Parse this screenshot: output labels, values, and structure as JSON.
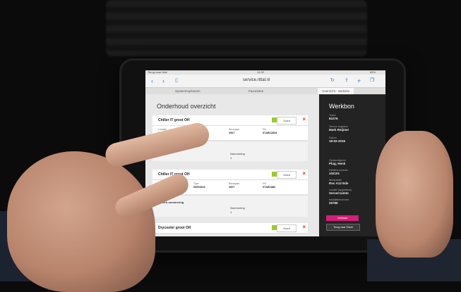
{
  "browser": {
    "back_label": "Terug naar Mail",
    "time": "14:32",
    "battery": "65%",
    "url": "service.rittal.nl"
  },
  "tabs": [
    "Systeemoplossen",
    "Favorieten",
    "Overzicht - Website"
  ],
  "page": {
    "title": "Onderhoud overzicht",
    "cards": [
      {
        "name": "Chiller IT groot OH",
        "status": "Goed",
        "fields": [
          {
            "label": "Locatie",
            "value": "Ede"
          },
          {
            "label": "Type",
            "value": "SKR4333"
          },
          {
            "label": "Bouwjaar",
            "value": "2007"
          },
          {
            "label": "FN",
            "value": "07AB12833"
          }
        ],
        "sub_label": "Nero-nummering",
        "sub_field_label": "Nummering",
        "sub_field_value": "1"
      },
      {
        "name": "Chiller IT groot OH",
        "status": "Goed",
        "fields": [
          {
            "label": "Locatie",
            "value": "Ede"
          },
          {
            "label": "Type",
            "value": "SKR4333"
          },
          {
            "label": "Bouwjaar",
            "value": "2007"
          },
          {
            "label": "FN",
            "value": "07AB1883"
          }
        ],
        "sub_label": "Nero-nummering",
        "sub_field_label": "Nummering",
        "sub_field_value": "1"
      },
      {
        "name": "Drycooler groot OH",
        "status": "Goed",
        "fields": [
          {
            "label": "Locatie",
            "value": ""
          },
          {
            "label": "Type",
            "value": ""
          },
          {
            "label": "Bouwjaar",
            "value": ""
          },
          {
            "label": "FN",
            "value": ""
          }
        ]
      }
    ]
  },
  "werkbon": {
    "title": "Werkbon",
    "fields": [
      {
        "label": "Ticket",
        "value": "81076"
      },
      {
        "label": "Service engineer",
        "value": "Mark Reijmer"
      },
      {
        "label": "Datum",
        "value": "18-02-2016"
      },
      {
        "label": "Opdrachtgever",
        "value": "Plug, Henk"
      },
      {
        "label": "Debiteurnummer",
        "value": "102101"
      },
      {
        "label": "Werkplaats",
        "value": "Roc A12 Ede"
      },
      {
        "label": "Locatie (apparatuur)",
        "value": "Serverruimte"
      },
      {
        "label": "Installatienummer",
        "value": "25789"
      }
    ],
    "primary_button": "Verklaart",
    "secondary_button": "Terug naar Sheet"
  },
  "colors": {
    "accent": "#d41f78",
    "ok_green": "#9ccc2a",
    "sidebar_bg": "#232323"
  }
}
